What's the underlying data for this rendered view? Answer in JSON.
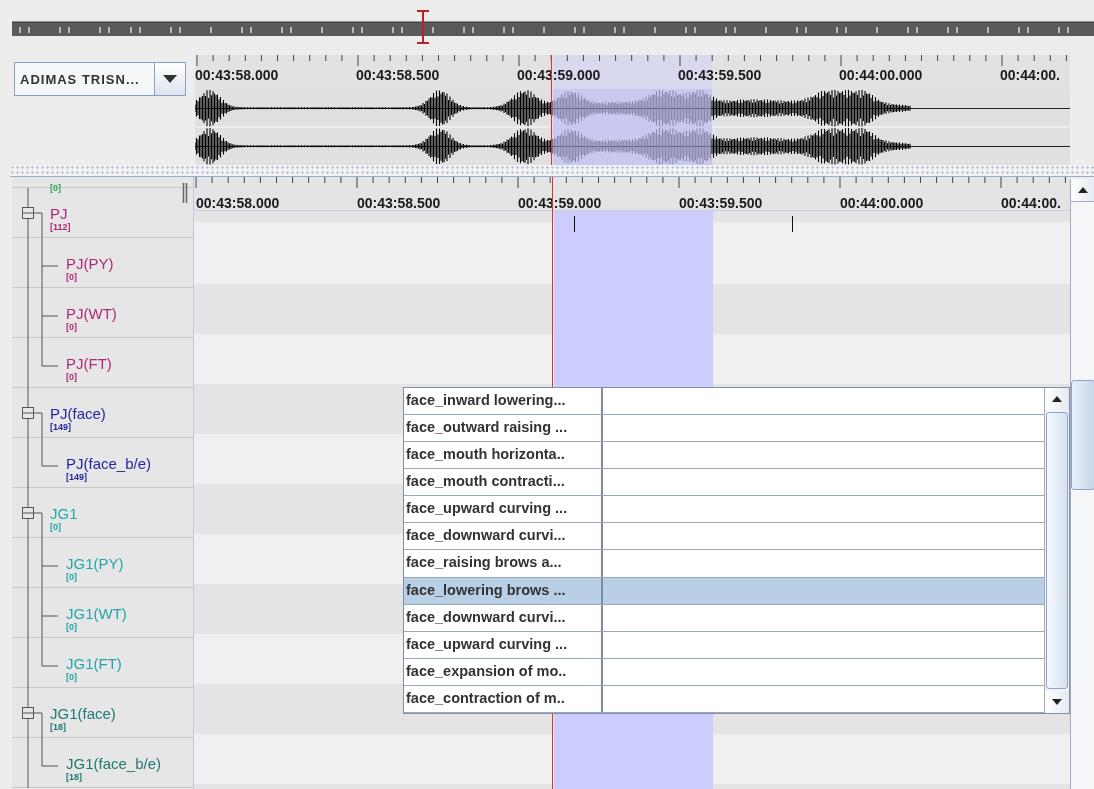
{
  "player": {
    "speaker_select": "ADIMAS TRISN...",
    "ruler_labels": [
      "00:43:58.000",
      "00:43:58.500",
      "00:43:59.000",
      "00:43:59.500",
      "00:44:00.000",
      "00:44:00."
    ]
  },
  "tiers": {
    "ruler_labels": [
      "00:43:58.000",
      "00:43:58.500",
      "00:43:59.000",
      "00:43:59.500",
      "00:44:00.000",
      "00:44:00."
    ],
    "cut_off_count": {
      "count": "[0]",
      "color": "#2aa850"
    },
    "items": [
      {
        "name": "PJ",
        "count": "[112]",
        "color": "#b02a70",
        "children": [
          {
            "name": "PJ(PY)",
            "count": "[0]"
          },
          {
            "name": "PJ(WT)",
            "count": "[0]"
          },
          {
            "name": "PJ(FT)",
            "count": "[0]"
          }
        ]
      },
      {
        "name": "PJ(face)",
        "count": "[149]",
        "color": "#2626a2",
        "children": [
          {
            "name": "PJ(face_b/e)",
            "count": "[149]"
          }
        ]
      },
      {
        "name": "JG1",
        "count": "[0]",
        "color": "#22a6aa",
        "children": [
          {
            "name": "JG1(PY)",
            "count": "[0]"
          },
          {
            "name": "JG1(WT)",
            "count": "[0]"
          },
          {
            "name": "JG1(FT)",
            "count": "[0]"
          }
        ]
      },
      {
        "name": "JG1(face)",
        "count": "[18]",
        "color": "#1f7a70",
        "children": [
          {
            "name": "JG1(face_b/e)",
            "count": "[18]"
          }
        ]
      }
    ]
  },
  "annotation_list": {
    "items": [
      {
        "label": "face_inward lowering...",
        "selected": false
      },
      {
        "label": "face_outward raising ...",
        "selected": false
      },
      {
        "label": "face_mouth horizonta..",
        "selected": false
      },
      {
        "label": "face_mouth contracti...",
        "selected": false
      },
      {
        "label": "face_upward curving ...",
        "selected": false
      },
      {
        "label": "face_downward curvi...",
        "selected": false
      },
      {
        "label": "face_raising brows a...",
        "selected": false
      },
      {
        "label": "face_lowering brows ...",
        "selected": true
      },
      {
        "label": "face_downward curvi...",
        "selected": false
      },
      {
        "label": "face_upward curving ...",
        "selected": false
      },
      {
        "label": "face_expansion of mo..",
        "selected": false
      },
      {
        "label": "face_contraction of m..",
        "selected": false
      }
    ]
  }
}
